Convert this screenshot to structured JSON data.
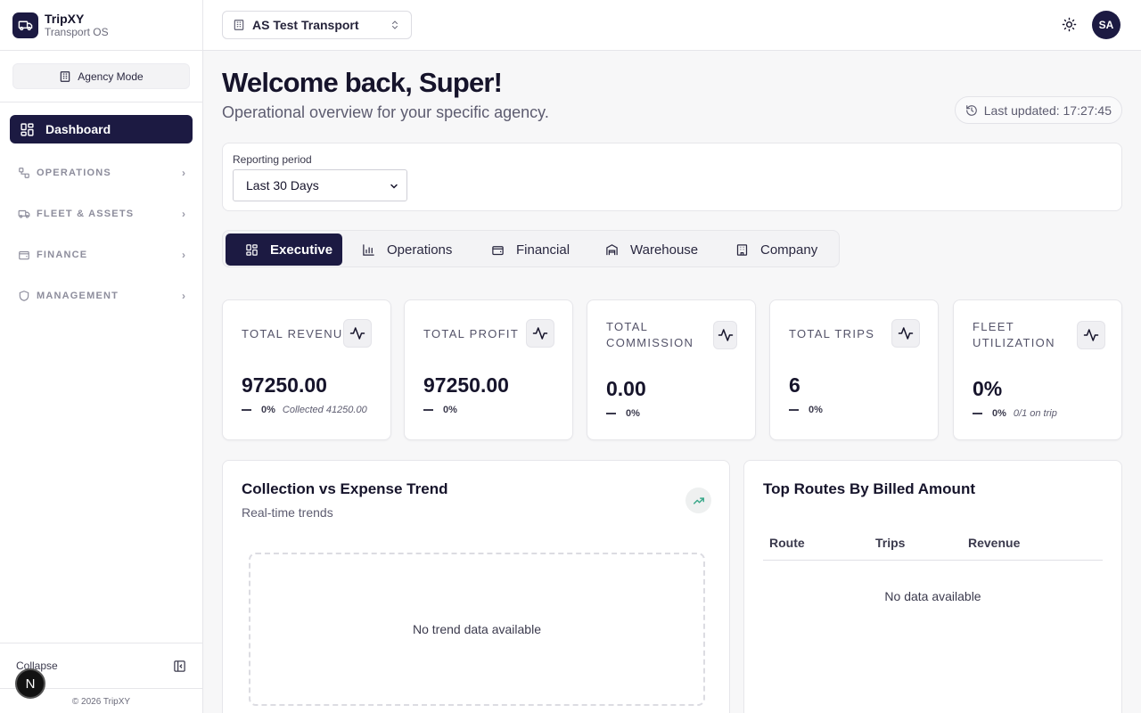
{
  "brand": {
    "name": "TripXY",
    "tagline": "Transport OS"
  },
  "sidebar": {
    "mode_label": "Agency Mode",
    "active_item": "Dashboard",
    "groups": [
      {
        "label": "OPERATIONS"
      },
      {
        "label": "FLEET & ASSETS"
      },
      {
        "label": "FINANCE"
      },
      {
        "label": "MANAGEMENT"
      }
    ],
    "collapse_label": "Collapse",
    "copyright": "© 2026 TripXY",
    "badge_letter": "N"
  },
  "topbar": {
    "agency_name": "AS Test Transport",
    "avatar_initials": "SA"
  },
  "header": {
    "welcome": "Welcome back, Super!",
    "subtitle": "Operational overview for your specific agency.",
    "last_updated": "Last updated: 17:27:45"
  },
  "filters": {
    "period_label": "Reporting period",
    "period_value": "Last 30 Days"
  },
  "tabs": [
    {
      "label": "Executive",
      "active": true
    },
    {
      "label": "Operations"
    },
    {
      "label": "Financial"
    },
    {
      "label": "Warehouse"
    },
    {
      "label": "Company"
    }
  ],
  "kpis": [
    {
      "label": "TOTAL REVENUE",
      "value": "97250.00",
      "change": "0%",
      "note": "Collected 41250.00"
    },
    {
      "label": "TOTAL PROFIT",
      "value": "97250.00",
      "change": "0%",
      "note": ""
    },
    {
      "label_line1": "TOTAL",
      "label_line2": "COMMISSION",
      "value": "0.00",
      "change": "0%",
      "note": ""
    },
    {
      "label": "TOTAL TRIPS",
      "value": "6",
      "change": "0%",
      "note": ""
    },
    {
      "label_line1": "FLEET",
      "label_line2": "UTILIZATION",
      "value": "0%",
      "change": "0%",
      "note": "0/1 on trip"
    }
  ],
  "trend_card": {
    "title": "Collection vs Expense Trend",
    "subtitle": "Real-time trends",
    "empty": "No trend data available"
  },
  "routes_card": {
    "title": "Top Routes By Billed Amount",
    "columns": [
      "Route",
      "Trips",
      "Revenue"
    ],
    "empty": "No data available"
  },
  "colors": {
    "primary": "#1c1a42",
    "background": "#f7f7f8",
    "trend_accent": "#3aa88a"
  }
}
